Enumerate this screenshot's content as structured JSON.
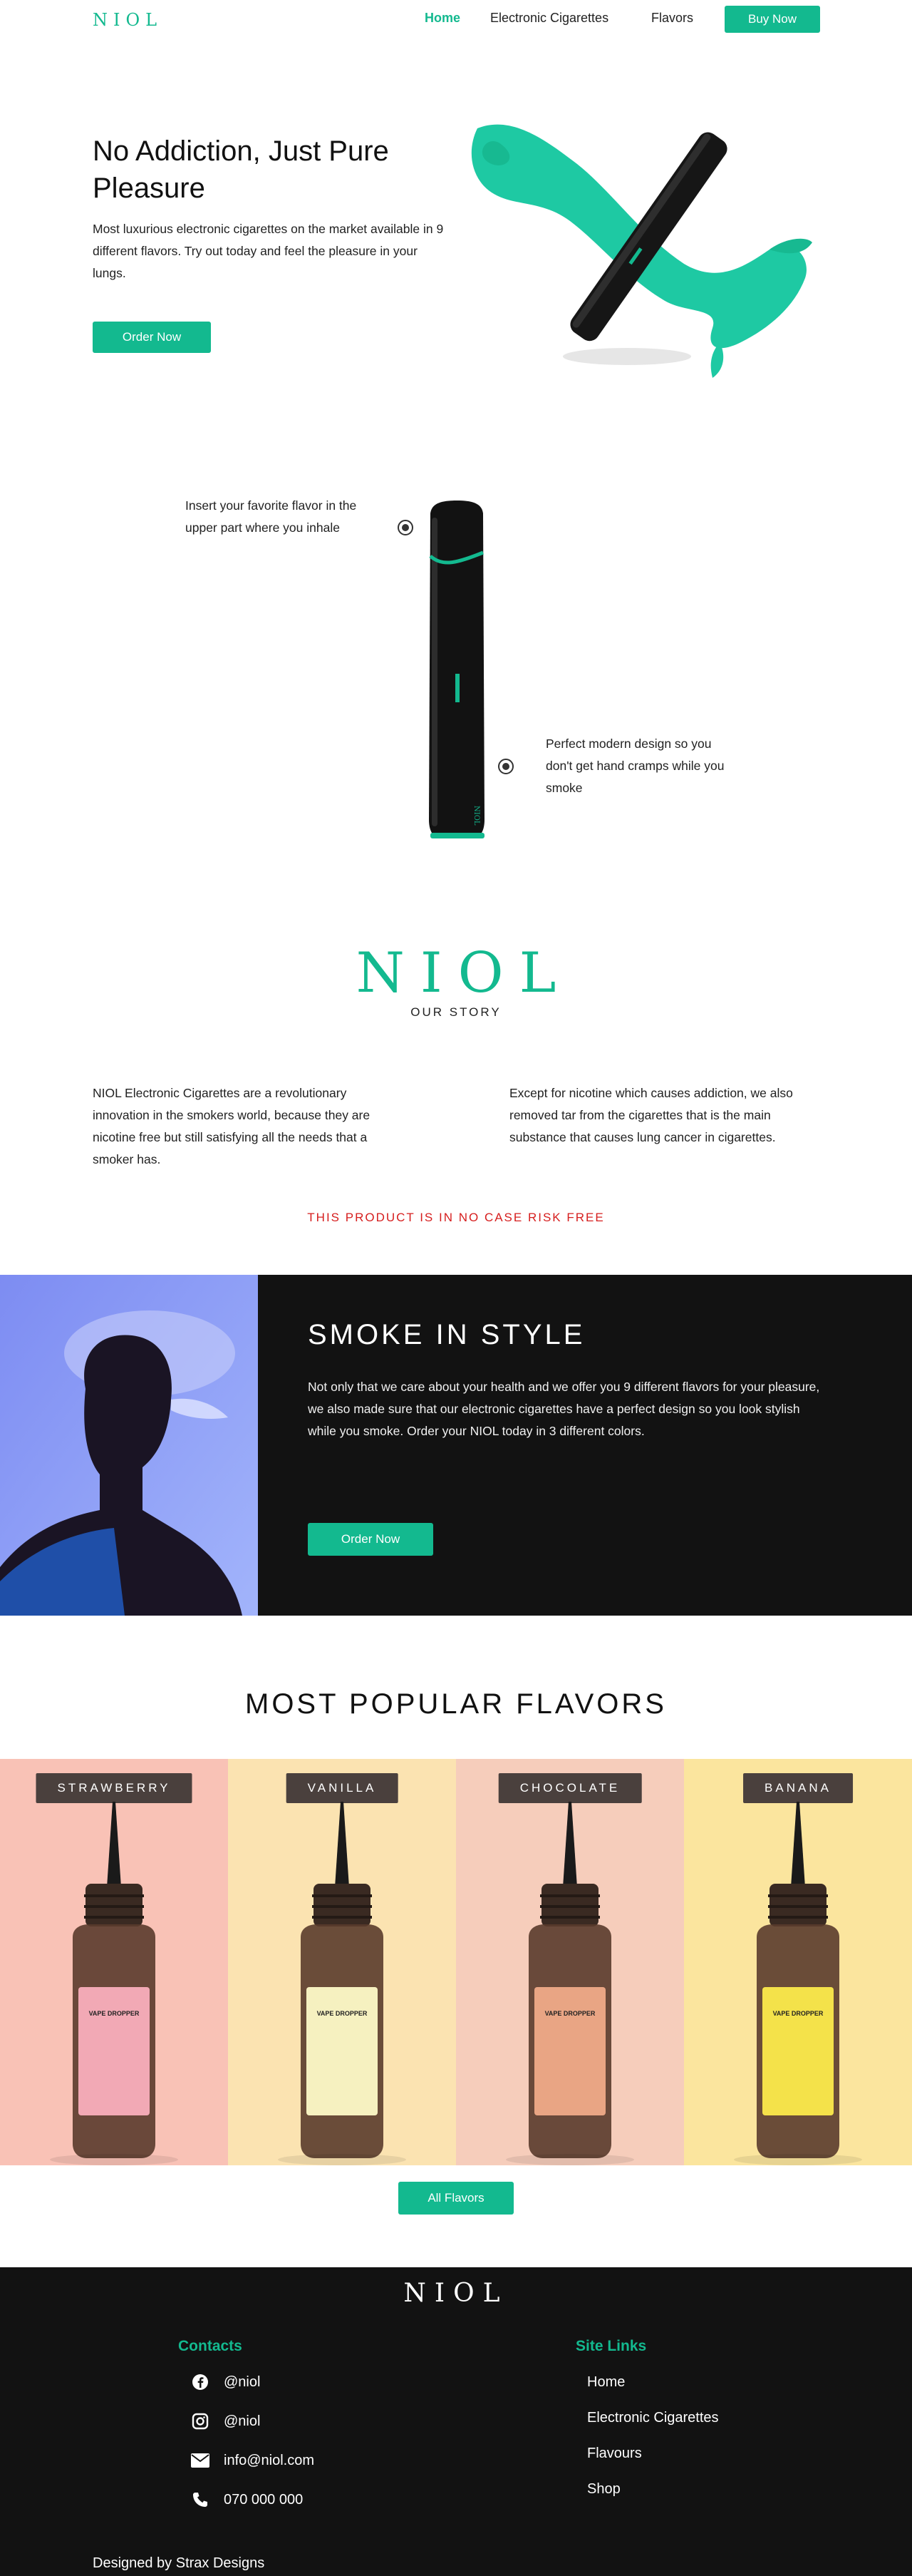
{
  "nav": {
    "logo": "NIOL",
    "links": [
      "Home",
      "Electronic Cigarettes",
      "Flavors"
    ],
    "buy_label": "Buy Now"
  },
  "hero": {
    "title": "No Addiction, Just Pure Pleasure",
    "text": "Most luxurious electronic cigarettes on the market available in 9 different flavors. Try out today and feel the pleasure in your lungs.",
    "cta": "Order Now"
  },
  "features": {
    "left_text": "Insert your favorite flavor in the upper part where you inhale",
    "right_text": "Perfect modern design so you don't get hand cramps while you smoke"
  },
  "story": {
    "logo": "NIOL",
    "subtitle": "OUR STORY",
    "left_text": "NIOL Electronic Cigarettes are a revolutionary innovation in the smokers world, because they are nicotine free but still satisfying all the needs that a smoker has.",
    "right_text": "Except for nicotine which causes addiction, we also removed tar from the cigarettes that is the main substance that causes lung cancer in cigarettes.",
    "risk": "THIS PRODUCT IS IN NO CASE RISK FREE"
  },
  "smoke": {
    "title": "SMOKE IN STYLE",
    "text": "Not only that we care about your health and we offer you 9 different flavors for your pleasure, we also made sure that our electronic cigarettes have a perfect design so you look stylish while you smoke. Order your NIOL today in 3 different colors.",
    "cta": "Order Now"
  },
  "flavors": {
    "title": "MOST POPULAR FLAVORS",
    "items": [
      {
        "name": "STRAWBERRY",
        "bg": "#f9c2b6",
        "bottle": "#f2a9b5"
      },
      {
        "name": "VANILLA",
        "bg": "#fbe3b1",
        "bottle": "#f6f1c0"
      },
      {
        "name": "CHOCOLATE",
        "bg": "#f6cdbb",
        "bottle": "#e9a584"
      },
      {
        "name": "BANANA",
        "bg": "#fbe59e",
        "bottle": "#f4e24a"
      }
    ],
    "bottle_brand": "VAPE DROPPER",
    "cta": "All Flavors"
  },
  "footer": {
    "logo": "NIOL",
    "contacts_title": "Contacts",
    "contacts": [
      {
        "icon": "facebook-icon",
        "text": "@niol"
      },
      {
        "icon": "instagram-icon",
        "text": "@niol"
      },
      {
        "icon": "mail-icon",
        "text": "info@niol.com"
      },
      {
        "icon": "phone-icon",
        "text": "070 000 000"
      }
    ],
    "links_title": "Site Links",
    "links": [
      "Home",
      "Electronic Cigarettes",
      "Flavours",
      "Shop"
    ],
    "designed": "Designed by Strax Designs"
  },
  "colors": {
    "accent": "#13b98f",
    "dark": "#121212",
    "risk": "#d61d1d"
  }
}
